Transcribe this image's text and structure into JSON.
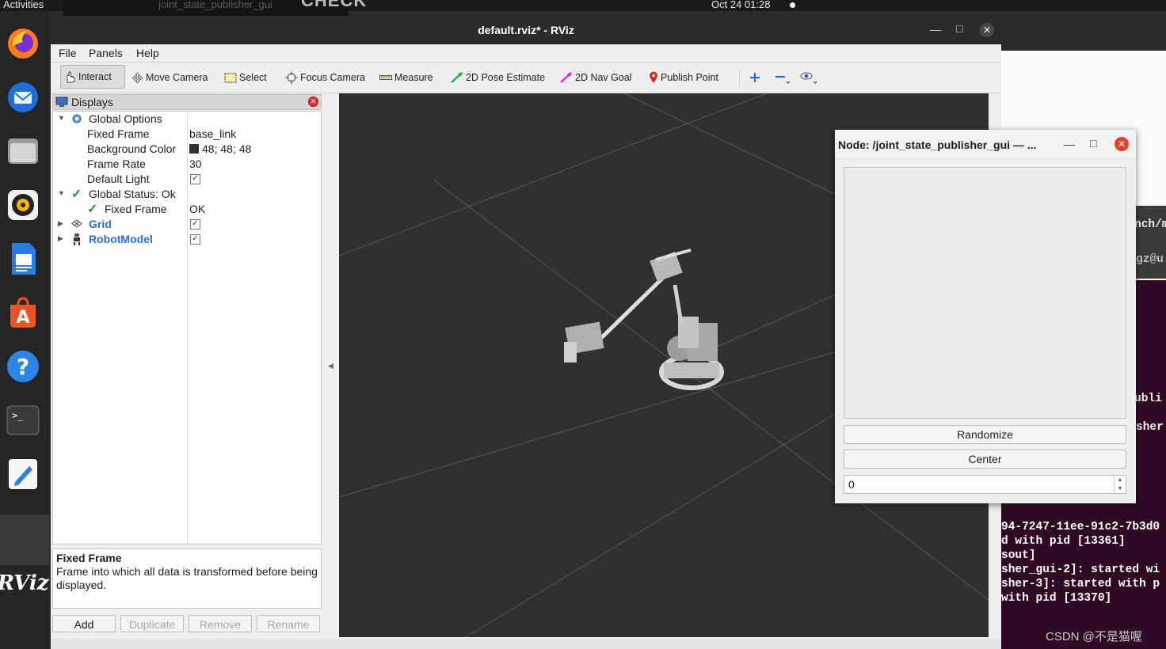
{
  "topbar": {
    "activities": "Activities",
    "clock": "Oct 24  01:28",
    "ghost_title": "joint_state_publisher_gui",
    "ghost_big": "CHECK"
  },
  "dock": {
    "items": [
      "firefox-icon",
      "thunderbird-icon",
      "files-icon",
      "rhythmbox-icon",
      "writer-icon",
      "app-center-icon",
      "help-icon",
      "terminal-icon",
      "text-editor-icon",
      "active-app",
      "rviz-icon"
    ],
    "rviz_label": "RViz"
  },
  "rviz": {
    "title": "default.rviz* - RViz",
    "menu": [
      "File",
      "Panels",
      "Help"
    ],
    "toolbar": {
      "interact": "Interact",
      "move_camera": "Move Camera",
      "select": "Select",
      "focus_camera": "Focus Camera",
      "measure": "Measure",
      "pose_estimate": "2D Pose Estimate",
      "nav_goal": "2D Nav Goal",
      "publish_point": "Publish Point"
    },
    "displays": {
      "title": "Displays",
      "rows": {
        "global_options": "Global Options",
        "fixed_frame_label": "Fixed Frame",
        "fixed_frame_value": "base_link",
        "bg_color_label": "Background Color",
        "bg_color_value": "48; 48; 48",
        "frame_rate_label": "Frame Rate",
        "frame_rate_value": "30",
        "default_light_label": "Default Light",
        "global_status_label": "Global Status: Ok",
        "status_fixed_frame_label": "Fixed Frame",
        "status_fixed_frame_value": "OK",
        "grid_label": "Grid",
        "robot_model_label": "RobotModel"
      },
      "description_title": "Fixed Frame",
      "description_text": "Frame into which all data is transformed before being displayed.",
      "buttons": [
        "Add",
        "Duplicate",
        "Remove",
        "Rename"
      ]
    },
    "colors": {
      "view_bg": "#303030",
      "accent_blue": "#2a6ed6"
    }
  },
  "jsp": {
    "title": "Node: /joint_state_publisher_gui — ...",
    "randomize": "Randomize",
    "center": "Center",
    "spin_value": "0"
  },
  "terminal": {
    "lines": [
      "94-7247-11ee-91c2-7b3d0",
      "d with pid [13361]",
      "sout]",
      "sher_gui-2]: started wi",
      "sher-3]: started with p",
      "with pid [13370]"
    ],
    "frag_top": "nch/m",
    "frag_user": "gz@u",
    "frag_publi": "ubli",
    "frag_sher": "sher"
  },
  "watermark": "CSDN @不是猫喔"
}
